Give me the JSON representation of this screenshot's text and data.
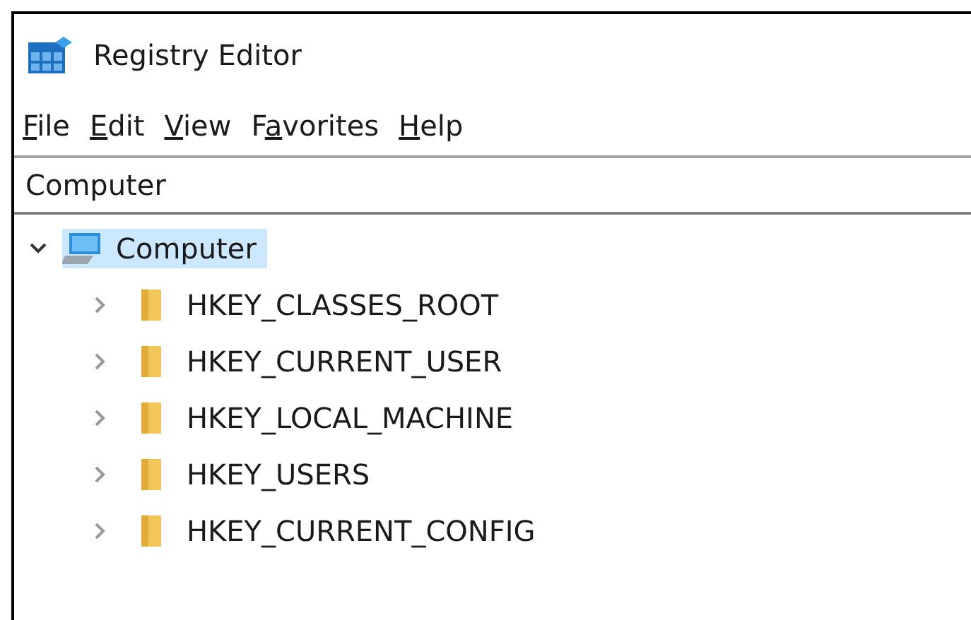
{
  "window": {
    "title": "Registry Editor"
  },
  "menu": [
    {
      "key": "F",
      "after": "ile"
    },
    {
      "key": "E",
      "after": "dit"
    },
    {
      "key": "V",
      "after": "iew"
    },
    {
      "before": "F",
      "key": "a",
      "after": "vorites"
    },
    {
      "key": "H",
      "after": "elp"
    }
  ],
  "address_bar": {
    "value": "Computer"
  },
  "tree": [
    {
      "label": "Computer",
      "kind": "computer",
      "expanded": true,
      "selected": true,
      "children": [
        {
          "label": "HKEY_CLASSES_ROOT",
          "kind": "folder",
          "expanded": false,
          "selected": false
        },
        {
          "label": "HKEY_CURRENT_USER",
          "kind": "folder",
          "expanded": false,
          "selected": false
        },
        {
          "label": "HKEY_LOCAL_MACHINE",
          "kind": "folder",
          "expanded": false,
          "selected": false
        },
        {
          "label": "HKEY_USERS",
          "kind": "folder",
          "expanded": false,
          "selected": false
        },
        {
          "label": "HKEY_CURRENT_CONFIG",
          "kind": "folder",
          "expanded": false,
          "selected": false
        }
      ]
    }
  ]
}
